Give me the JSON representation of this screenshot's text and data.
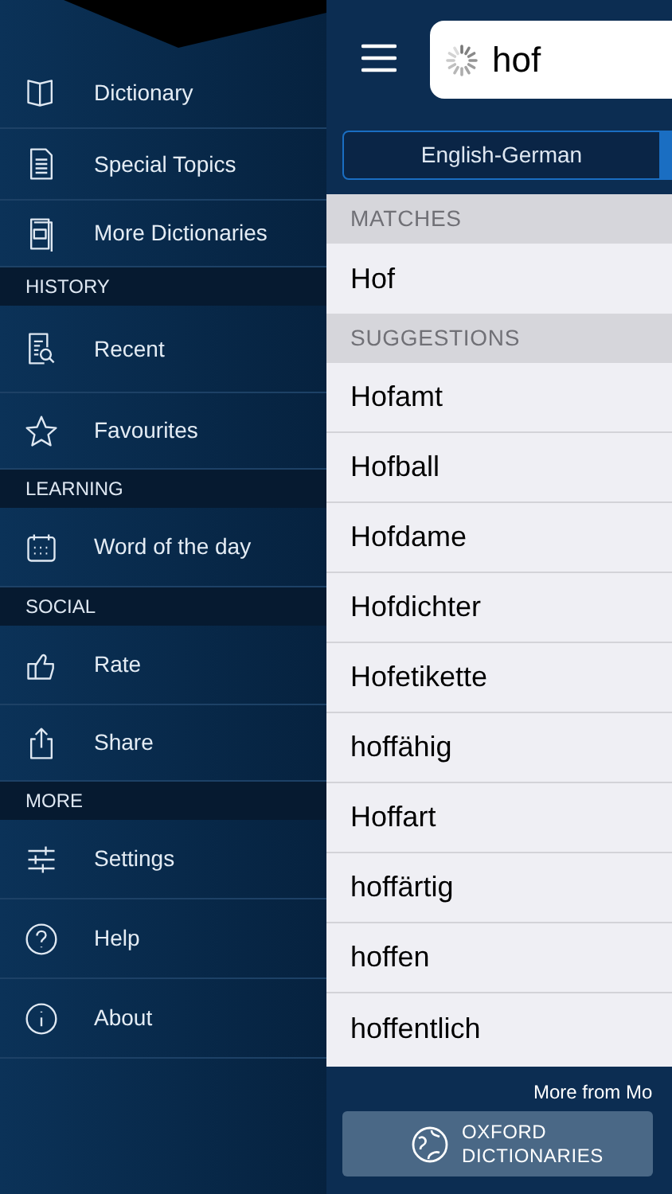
{
  "sidebar": {
    "sections": [
      {
        "items": [
          {
            "label": "Dictionary"
          },
          {
            "label": "Special Topics"
          },
          {
            "label": "More Dictionaries"
          }
        ]
      },
      {
        "header": "HISTORY",
        "items": [
          {
            "label": "Recent"
          },
          {
            "label": "Favourites"
          }
        ]
      },
      {
        "header": "LEARNING",
        "items": [
          {
            "label": "Word of the day"
          }
        ]
      },
      {
        "header": "SOCIAL",
        "items": [
          {
            "label": "Rate"
          },
          {
            "label": "Share"
          }
        ]
      },
      {
        "header": "MORE",
        "items": [
          {
            "label": "Settings"
          },
          {
            "label": "Help"
          },
          {
            "label": "About"
          }
        ]
      }
    ]
  },
  "search": {
    "value": "hof"
  },
  "tabs": [
    {
      "label": "English-German",
      "selected": false
    }
  ],
  "results": [
    {
      "header": "MATCHES",
      "items": [
        "Hof"
      ]
    },
    {
      "header": "SUGGESTIONS",
      "items": [
        "Hofamt",
        "Hofball",
        "Hofdame",
        "Hofdichter",
        "Hofetikette",
        "hoffähig",
        "Hoffart",
        "hoffärtig",
        "hoffen",
        "hoffentlich"
      ]
    }
  ],
  "footer": {
    "text": "More from Mo",
    "button": [
      "OXFORD",
      "DICTIONARIES"
    ]
  }
}
